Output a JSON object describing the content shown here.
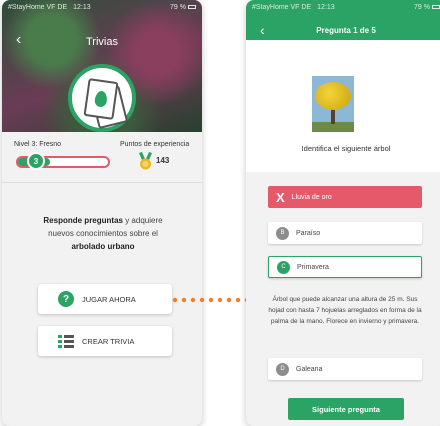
{
  "left_screen": {
    "status": {
      "carrier": "#StayHome VF DE",
      "time": "12:13",
      "battery": "79 %"
    },
    "title": "Trivias",
    "level_label": "Nivel 3: Fresno",
    "level_number": "3",
    "level_progress": 0.35,
    "xp_label": "Puntos de experiencia",
    "xp_value": "143",
    "intro": {
      "bold1": "Responde preguntas",
      "text1": " y adquiere nuevos conocimientos sobre el ",
      "bold2": "arbolado urbano"
    },
    "play_label": "JUGAR AHORA",
    "create_label": "CREAR TRIVIA"
  },
  "right_screen": {
    "status": {
      "carrier": "#StayHome VF DE",
      "time": "12:13",
      "battery": "79 %"
    },
    "title": "Pregunta  1 de 5",
    "question": "Identifica el siguiente árbol",
    "options": [
      {
        "letter": "X",
        "label": "Lluvia de oro",
        "state": "wrong"
      },
      {
        "letter": "B",
        "label": "Paraíso",
        "state": "normal"
      },
      {
        "letter": "C",
        "label": "Primavera",
        "state": "correct"
      },
      {
        "letter": "D",
        "label": "Galeana",
        "state": "normal"
      }
    ],
    "explanation": "Árbol que puede alcanzar una altura de 25 m. Sus hojad con hasta 7 hojuelas arreglados en forma de la palma de la mano. Florece en invierno y primavera.",
    "next_label": "Siguiente pregunta"
  },
  "colors": {
    "green": "#2aa364",
    "red": "#e5596a",
    "orange": "#f07e2b"
  }
}
